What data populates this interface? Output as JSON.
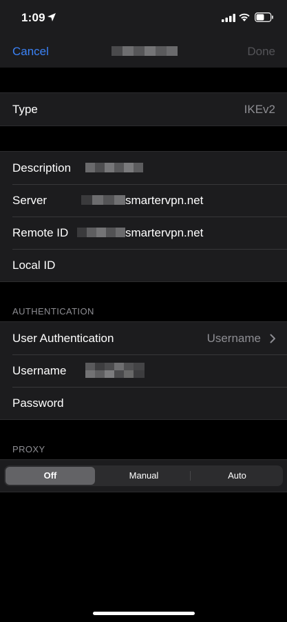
{
  "status_bar": {
    "time": "1:09"
  },
  "nav": {
    "cancel_label": "Cancel",
    "done_label": "Done"
  },
  "type_row": {
    "label": "Type",
    "value": "IKEv2"
  },
  "connection": {
    "description_label": "Description",
    "server_label": "Server",
    "server_value": "smartervpn.net",
    "remote_id_label": "Remote ID",
    "remote_id_value": "smartervpn.net",
    "local_id_label": "Local ID"
  },
  "authentication": {
    "header": "AUTHENTICATION",
    "user_auth_label": "User Authentication",
    "user_auth_value": "Username",
    "username_label": "Username",
    "password_label": "Password"
  },
  "proxy": {
    "header": "PROXY",
    "options": [
      "Off",
      "Manual",
      "Auto"
    ],
    "selected": "Off"
  },
  "colors": {
    "accent": "#3b82f6",
    "background": "#000000",
    "cell": "#1c1c1e",
    "secondary_text": "#8e8e93"
  }
}
